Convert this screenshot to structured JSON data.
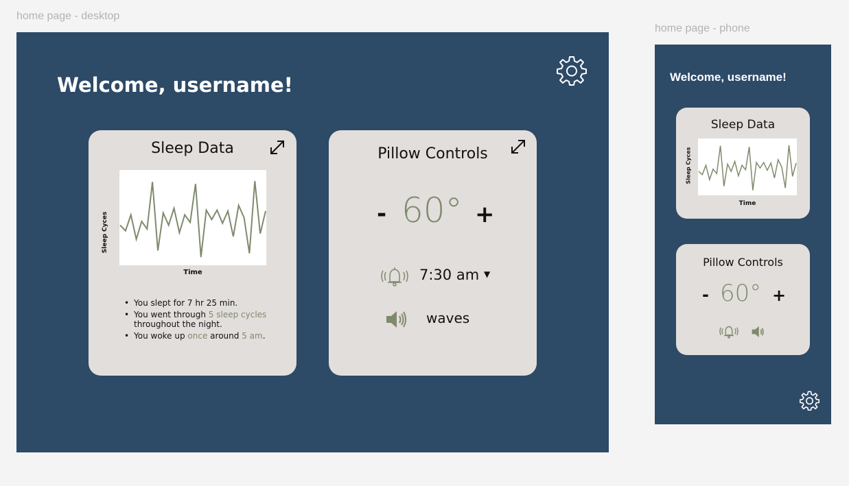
{
  "canvas": {
    "desktop_label": "home page - desktop",
    "phone_label": "home page - phone"
  },
  "desktop": {
    "welcome": "Welcome, username!",
    "sleep_card": {
      "title": "Sleep Data",
      "ylabel": "Sleep Cyces",
      "xlabel": "Time",
      "bullets": {
        "b1": {
          "text": "You slept for 7 hr 25 min."
        },
        "b2": {
          "pre": "You went through ",
          "highlight": "5 sleep cycles",
          "post": "throughout the night."
        },
        "b3": {
          "pre": "You woke up ",
          "highlight1": "once",
          "mid": " around ",
          "highlight2": "5 am",
          "post": "."
        }
      }
    },
    "pillow_card": {
      "title": "Pillow Controls",
      "minus": "-",
      "temperature": "60°",
      "plus": "+",
      "alarm_time": "7:30 am",
      "dropdown_arrow": "▼",
      "sound": "waves"
    }
  },
  "phone": {
    "welcome": "Welcome, username!",
    "sleep_card": {
      "title": "Sleep Data",
      "ylabel": "Sleep Cyces",
      "xlabel": "Time"
    },
    "pillow_card": {
      "title": "Pillow Controls",
      "minus": "-",
      "temperature": "60°",
      "plus": "+"
    }
  },
  "colors": {
    "frame_bg": "#2d4a67",
    "card_bg": "#e2dedb",
    "accent_green": "#7e8a6c",
    "canvas_bg": "#f4f4f4"
  },
  "icons": [
    "gear-icon",
    "expand-icon",
    "bell-icon",
    "speaker-icon",
    "caret-down-icon"
  ],
  "chart_data": {
    "type": "line",
    "xlabel": "Time",
    "ylabel": "Sleep Cyces",
    "grid": false,
    "values": [
      0.42,
      0.36,
      0.53,
      0.27,
      0.46,
      0.38,
      0.88,
      0.15,
      0.55,
      0.42,
      0.6,
      0.34,
      0.53,
      0.45,
      0.86,
      0.08,
      0.58,
      0.48,
      0.58,
      0.44,
      0.57,
      0.3,
      0.63,
      0.5,
      0.12,
      0.89,
      0.33,
      0.57
    ]
  }
}
